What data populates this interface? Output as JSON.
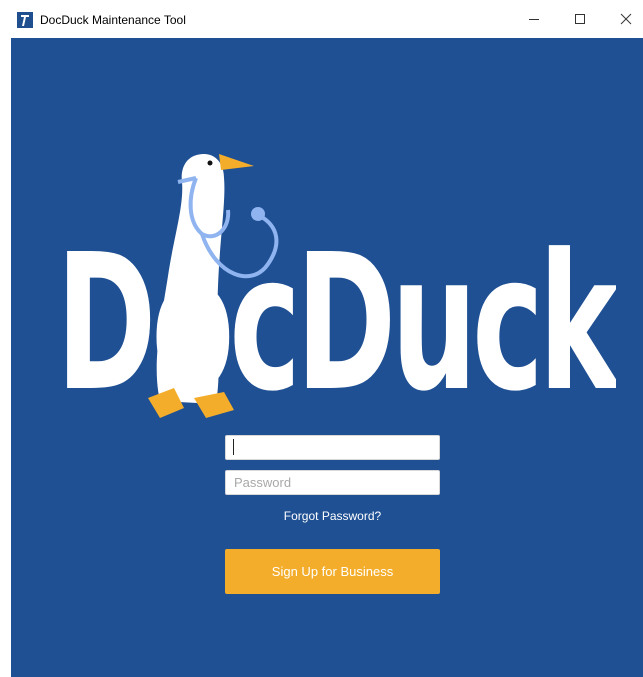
{
  "window": {
    "title": "DocDuck Maintenance Tool",
    "app_icon": "docduck-app-icon",
    "controls": {
      "minimize_icon": "minimize-icon",
      "maximize_icon": "maximize-icon",
      "close_icon": "close-icon"
    }
  },
  "logo": {
    "text": "DocDuck",
    "mascot": "goose-with-stethoscope"
  },
  "login": {
    "username_value": "",
    "username_placeholder": "",
    "password_placeholder": "Password",
    "forgot_password_label": "Forgot Password?",
    "signup_label": "Sign Up for Business"
  },
  "colors": {
    "background": "#1f5094",
    "accent": "#f4ad2a",
    "logo_text": "#ffffff",
    "stethoscope": "#8fb4f0",
    "beak_feet": "#f4ad2a"
  }
}
